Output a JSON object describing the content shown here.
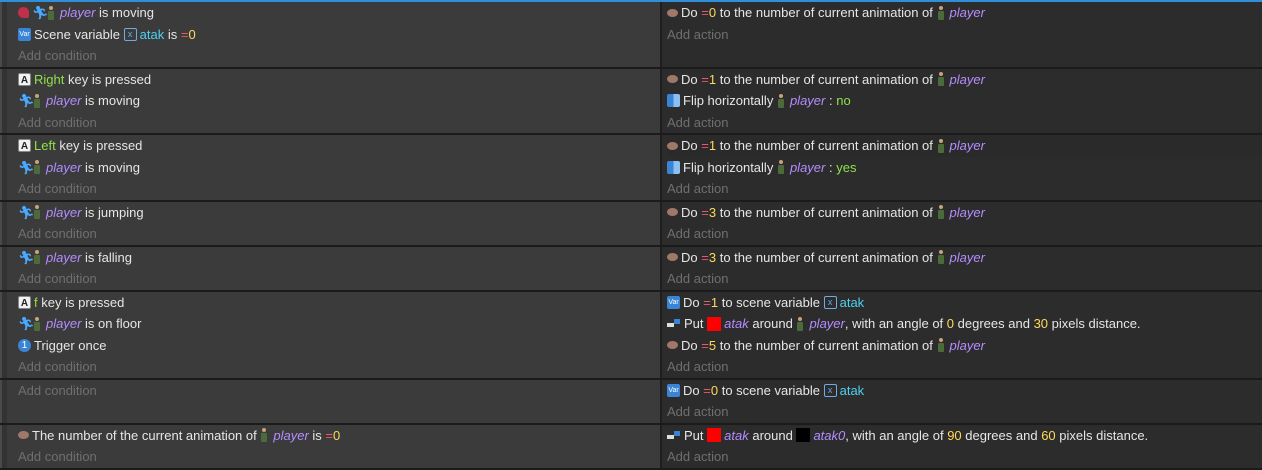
{
  "colors": {
    "object": "#b58cff",
    "number": "#ffd95a",
    "key": "#8fe24a",
    "operator": "#e85a6a",
    "variable": "#4fd0f0",
    "accent": "#2f8fd8"
  },
  "placeholders": {
    "add_condition": "Add condition",
    "add_action": "Add action"
  },
  "events": [
    {
      "conditions": [
        {
          "icons": [
            "bubble-icon",
            "runner-icon",
            "player-sprite-icon"
          ],
          "obj": "player",
          "text": "is moving"
        },
        {
          "icons": [
            "scene-variable-icon"
          ],
          "pre": "Scene variable",
          "var": "atak",
          "text": "is",
          "op": "=",
          "num": "0"
        }
      ],
      "actions": [
        {
          "icon": "animation-icon",
          "pre": "Do",
          "op": "=",
          "num": "0",
          "text": "to the number of current animation of",
          "obj": "player"
        }
      ]
    },
    {
      "conditions": [
        {
          "icons": [
            "key-icon"
          ],
          "key": "Right",
          "text": "key is pressed"
        },
        {
          "icons": [
            "runner-icon",
            "player-sprite-icon"
          ],
          "obj": "player",
          "text": "is moving"
        }
      ],
      "actions": [
        {
          "icon": "animation-icon",
          "pre": "Do",
          "op": "=",
          "num": "1",
          "text": "to the number of current animation of",
          "obj": "player"
        },
        {
          "icon": "flip-icon",
          "pre": "Flip horizontally",
          "obj": "player",
          "sep": ":",
          "value": "no"
        }
      ]
    },
    {
      "conditions": [
        {
          "icons": [
            "key-icon"
          ],
          "key": "Left",
          "text": "key is pressed"
        },
        {
          "icons": [
            "runner-icon",
            "player-sprite-icon"
          ],
          "obj": "player",
          "text": "is moving"
        }
      ],
      "actions": [
        {
          "icon": "animation-icon",
          "pre": "Do",
          "op": "=",
          "num": "1",
          "text": "to the number of current animation of",
          "obj": "player"
        },
        {
          "icon": "flip-icon",
          "pre": "Flip horizontally",
          "obj": "player",
          "sep": ":",
          "value": "yes"
        }
      ]
    },
    {
      "conditions": [
        {
          "icons": [
            "runner-icon",
            "player-sprite-icon"
          ],
          "obj": "player",
          "text": "is jumping"
        }
      ],
      "actions": [
        {
          "icon": "animation-icon",
          "pre": "Do",
          "op": "=",
          "num": "3",
          "text": "to the number of current animation of",
          "obj": "player"
        }
      ]
    },
    {
      "conditions": [
        {
          "icons": [
            "runner-icon",
            "player-sprite-icon"
          ],
          "obj": "player",
          "text": "is falling"
        }
      ],
      "actions": [
        {
          "icon": "animation-icon",
          "pre": "Do",
          "op": "=",
          "num": "3",
          "text": "to the number of current animation of",
          "obj": "player"
        }
      ]
    },
    {
      "conditions": [
        {
          "icons": [
            "key-icon"
          ],
          "key": "f",
          "text": "key is pressed"
        },
        {
          "icons": [
            "runner-icon",
            "player-sprite-icon"
          ],
          "obj": "player",
          "text": "is on floor"
        },
        {
          "icons": [
            "trigger-once-icon"
          ],
          "pre": "Trigger once"
        }
      ],
      "actions": [
        {
          "icon": "scene-variable-icon",
          "pre": "Do",
          "op": "=",
          "num": "1",
          "text": "to scene variable",
          "var": "atak"
        },
        {
          "icon": "put-icon",
          "pre": "Put",
          "swatch": "red",
          "obj1": "atak",
          "mid": "around",
          "obj2": "player",
          "obj2_icon": "player-sprite-icon",
          "angle_pre": ", with an angle of",
          "angle": "0",
          "dist_pre": "degrees and",
          "dist": "30",
          "post": "pixels distance."
        },
        {
          "icon": "animation-icon",
          "pre": "Do",
          "op": "=",
          "num": "5",
          "text": "to the number of current animation of",
          "obj": "player"
        }
      ]
    },
    {
      "conditions": [],
      "actions": [
        {
          "icon": "scene-variable-icon",
          "pre": "Do",
          "op": "=",
          "num": "0",
          "text": "to scene variable",
          "var": "atak"
        }
      ]
    },
    {
      "conditions": [
        {
          "icons": [
            "animation-icon"
          ],
          "pre": "The number of the current animation of",
          "obj": "player",
          "text": "is",
          "op": "=",
          "num": "0"
        }
      ],
      "actions": [
        {
          "icon": "put-icon",
          "pre": "Put",
          "swatch": "red",
          "obj1": "atak",
          "mid": "around",
          "obj2": "atak0",
          "obj2_icon": "black-square-icon",
          "angle_pre": ", with an angle of",
          "angle": "90",
          "dist_pre": "degrees and",
          "dist": "60",
          "post": "pixels distance."
        }
      ]
    }
  ]
}
